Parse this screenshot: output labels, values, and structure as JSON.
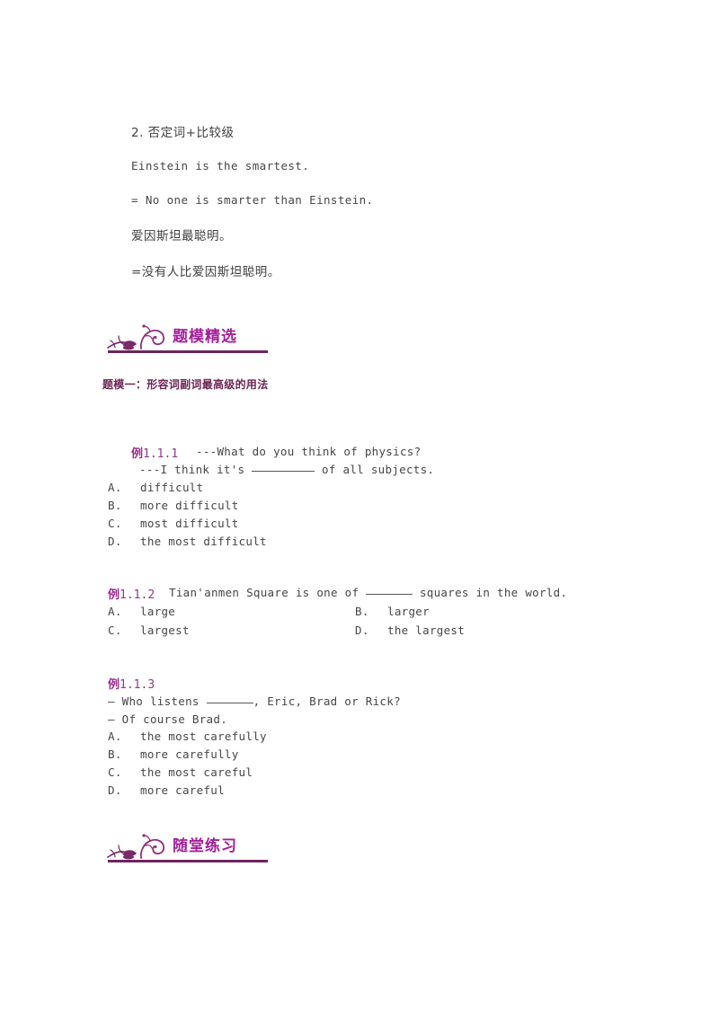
{
  "document": {
    "grammar_note": {
      "heading": "2.  否定词+比较级",
      "lines": [
        "Einstein is the smartest.",
        "= No one is smarter than Einstein.",
        "爱因斯坦最聪明。",
        "=没有人比爱因斯坦聪明。"
      ]
    },
    "sections": [
      {
        "title": "题模精选",
        "ornament": "vine-flourish-icon"
      },
      {
        "title": "随堂练习",
        "ornament": "vine-flourish-icon"
      }
    ],
    "subheading": "题模一：形容词副词最高级的用法",
    "questions": [
      {
        "label_cjk": "例",
        "label_num": "1.1.1",
        "stem_line_1": "---What do you think of physics?",
        "stem_line_2_before": "---I think it's",
        "stem_line_2_after": "of all subjects.",
        "layout": "single-column",
        "options": [
          {
            "letter": "A.",
            "text": "difficult"
          },
          {
            "letter": "B.",
            "text": "more difficult"
          },
          {
            "letter": "C.",
            "text": "most difficult"
          },
          {
            "letter": "D.",
            "text": "the most difficult"
          }
        ]
      },
      {
        "label_cjk": "例",
        "label_num": "1.1.2",
        "stem_line_1_before": "Tian'anmen Square is one of",
        "stem_line_1_after": "squares in the world.",
        "layout": "two-column",
        "options": [
          {
            "letter": "A.",
            "text": "large"
          },
          {
            "letter": "B.",
            "text": "larger"
          },
          {
            "letter": "C.",
            "text": "largest"
          },
          {
            "letter": "D.",
            "text": "the largest"
          }
        ]
      },
      {
        "label_cjk": "例",
        "label_num": "1.1.3",
        "stem_line_1_before": "— Who listens",
        "stem_line_1_after": ", Eric, Brad or Rick?",
        "stem_line_2": "— Of course Brad.",
        "layout": "single-column",
        "options": [
          {
            "letter": "A.",
            "text": "the most carefully"
          },
          {
            "letter": "B.",
            "text": "more carefully"
          },
          {
            "letter": "C.",
            "text": "the most careful"
          },
          {
            "letter": "D.",
            "text": "more careful"
          }
        ]
      }
    ],
    "colors": {
      "section_title": "#A3209C",
      "section_rule": "#6E2461",
      "subheading": "#6B2452",
      "question_label": "#9B2B8E",
      "body_text": "#45464a"
    }
  }
}
